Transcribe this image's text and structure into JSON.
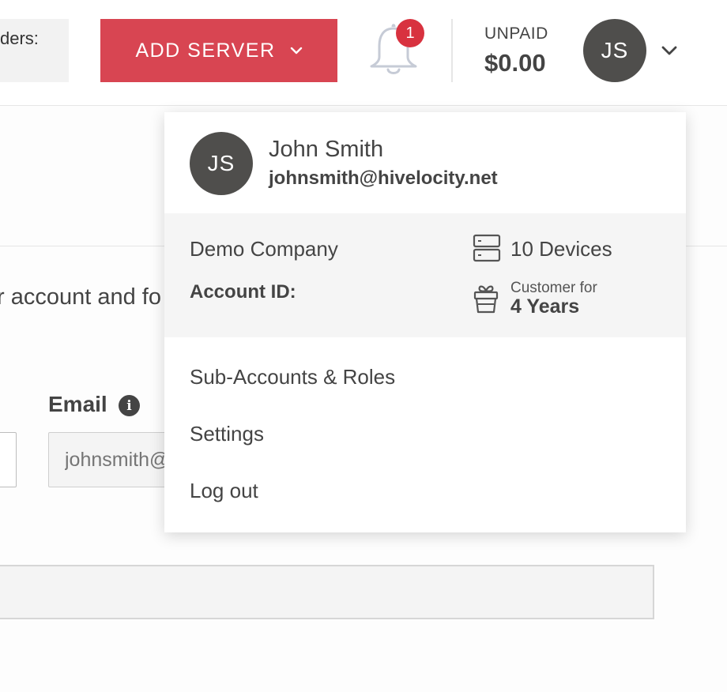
{
  "header": {
    "orders_label": "ders:",
    "add_server_label": "ADD SERVER",
    "notification_count": "1",
    "unpaid_label": "UNPAID",
    "unpaid_amount": "$0.00",
    "avatar_initials": "JS"
  },
  "page": {
    "intro_text": "r account and fo",
    "email_label": "Email",
    "email_value": "johnsmith@hivelocity.net"
  },
  "account_menu": {
    "avatar_initials": "JS",
    "name": "John Smith",
    "email": "johnsmith@hivelocity.net",
    "company": "Demo Company",
    "account_id_label": "Account ID:",
    "devices": "10 Devices",
    "customer_for_label": "Customer for",
    "customer_duration": "4 Years",
    "items": [
      {
        "label": "Sub-Accounts & Roles"
      },
      {
        "label": "Settings"
      },
      {
        "label": "Log out"
      }
    ]
  },
  "colors": {
    "accent": "#d84552",
    "badge": "#d8323f",
    "avatar": "#4f4e4c"
  },
  "icons": [
    "chevron-down-icon",
    "bell-icon",
    "info-icon",
    "server-icon",
    "gift-icon"
  ]
}
